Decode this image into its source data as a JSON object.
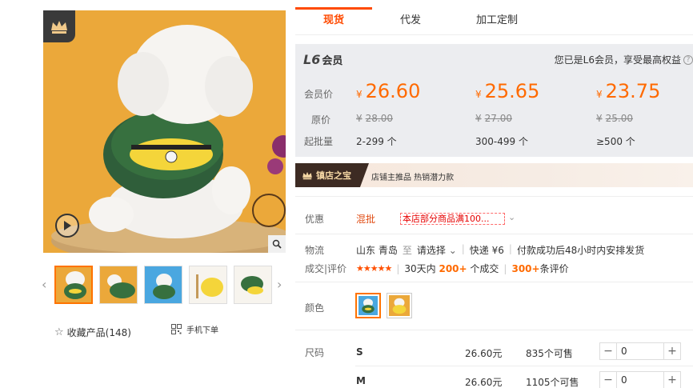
{
  "gallery": {
    "favorite_label": "收藏产品(148)",
    "mobile_order_label": "手机下单",
    "accent": "#ff7300",
    "icons": [
      "crown-icon",
      "play-icon",
      "zoom-icon",
      "chevron-left-icon",
      "chevron-right-icon",
      "star-outline-icon",
      "qrcode-icon"
    ]
  },
  "tabs": [
    {
      "label": "现货"
    },
    {
      "label": "代发"
    },
    {
      "label": "加工定制"
    }
  ],
  "member": {
    "level": "L6",
    "title": "会员",
    "notice": "您已是L6会员，享受最高权益"
  },
  "prices": {
    "member_label": "会员价",
    "original_label": "原价",
    "min_qty_label": "起批量",
    "currency": "¥",
    "tiers": [
      {
        "price": "26.60",
        "original": "28.00",
        "qty": "2-299 个"
      },
      {
        "price": "25.65",
        "original": "27.00",
        "qty": "300-499 个"
      },
      {
        "price": "23.75",
        "original": "25.00",
        "qty": "≥500 个"
      }
    ]
  },
  "shop": {
    "badge": "镇店之宝",
    "text": "店铺主推品  热销潜力款"
  },
  "promo": {
    "label": "优惠",
    "tag": "混批",
    "box": "本店部分商品满100..."
  },
  "logistics": {
    "label": "物流",
    "origin": "山东 青岛",
    "to": "至",
    "dest": "请选择",
    "express": "快递 ¥6",
    "note": "付款成功后48小时内安排发货"
  },
  "deals": {
    "label": "成交|评价",
    "stars": "★★★★★",
    "sold_prefix": "30天内",
    "sold_count": "200+",
    "sold_suffix": "个成交",
    "review_count": "300+",
    "review_suffix": "条评价"
  },
  "color": {
    "label": "颜色"
  },
  "size": {
    "label": "尺码",
    "rows": [
      {
        "name": "S",
        "price": "26.60元",
        "stock": "835个可售",
        "qty": "0"
      },
      {
        "name": "M",
        "price": "26.60元",
        "stock": "1105个可售",
        "qty": "0"
      }
    ]
  }
}
